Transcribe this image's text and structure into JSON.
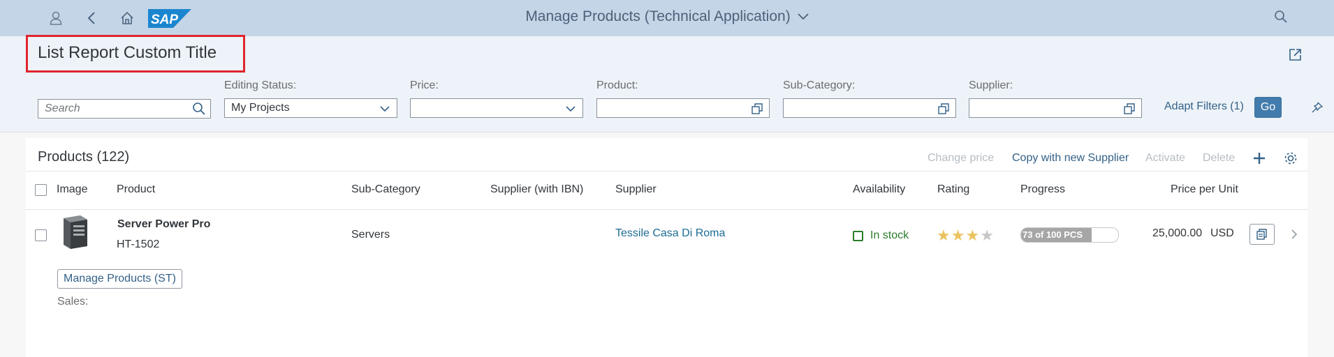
{
  "shell": {
    "title": "Manage Products (Technical Application)",
    "logo_text": "SAP",
    "icons": [
      "user-icon",
      "back-icon",
      "home-icon",
      "search-icon"
    ]
  },
  "header": {
    "page_title": "List Report Custom Title",
    "search_placeholder": "Search",
    "filters": [
      {
        "label": "Editing Status:",
        "value": "My Projects",
        "control": "dropdown"
      },
      {
        "label": "Price:",
        "value": "",
        "control": "dropdown"
      },
      {
        "label": "Product:",
        "value": "",
        "control": "value-help"
      },
      {
        "label": "Sub-Category:",
        "value": "",
        "control": "value-help"
      },
      {
        "label": "Supplier:",
        "value": "",
        "control": "value-help"
      }
    ],
    "adapt_filters": "Adapt Filters (1)",
    "go": "Go"
  },
  "table": {
    "title": "Products (122)",
    "actions": {
      "change_price": "Change price",
      "copy_supplier": "Copy with new Supplier",
      "activate": "Activate",
      "delete": "Delete"
    },
    "columns": [
      "Image",
      "Product",
      "Sub-Category",
      "Supplier (with IBN)",
      "Supplier",
      "Availability",
      "Rating",
      "Progress",
      "Price per Unit"
    ],
    "rows": [
      {
        "product_name": "Server Power Pro",
        "product_id": "HT-1502",
        "sub_category": "Servers",
        "supplier_ibn": "",
        "supplier": "Tessile Casa Di Roma",
        "availability": "In stock",
        "rating": 3,
        "rating_max": 4,
        "progress_text": "73 of 100 PCS",
        "progress_value": 0.73,
        "price": "25,000.00",
        "currency": "USD",
        "nav_button": "Manage Products (ST)",
        "sales_label": "Sales:"
      }
    ]
  },
  "colors": {
    "shell_bg": "#c5d5e8",
    "header_bg": "#edf3f8",
    "highlight_border": "#e02530",
    "go_button": "#427cac",
    "link": "#1d6c93",
    "success": "#2b7d2b",
    "star": "#e9c35e"
  }
}
